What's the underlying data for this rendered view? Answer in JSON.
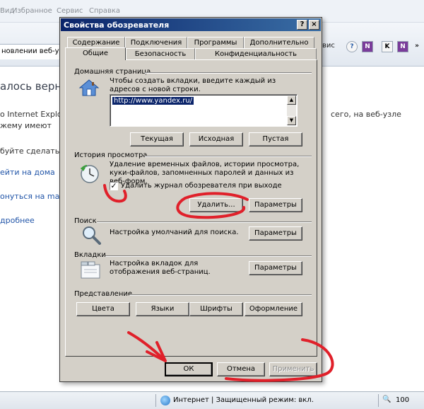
{
  "background_window": {
    "menu": [
      "Вид",
      "Избранное",
      "Сервис",
      "Справка"
    ],
    "tab_label": "новлении веб-узла",
    "toolbar_right_label": "вис",
    "heading": "алось верн",
    "lines": [
      "o Internet Explo",
      "жему имеют",
      "буйте сделать с"
    ],
    "right_lines": [
      "сего, на веб-узле"
    ],
    "links": [
      "ейти на дома",
      "онуться на mai",
      "дробнее"
    ],
    "status": {
      "zone": "Интернет | Защищенный режим: вкл.",
      "zoom": "100"
    }
  },
  "dialog": {
    "title": "Свойства обозревателя",
    "help_button": "?",
    "close_button": "×",
    "tabs_row1": [
      "Содержание",
      "Подключения",
      "Программы",
      "Дополнительно"
    ],
    "tabs_row2": [
      "Общие",
      "Безопасность",
      "Конфиденциальность"
    ],
    "home": {
      "group_label": "Домашняя страница",
      "description": "Чтобы создать вкладки, введите каждый из адресов с новой строки.",
      "url": "http://www.yandex.ru/",
      "buttons": [
        "Текущая",
        "Исходная",
        "Пустая"
      ]
    },
    "history": {
      "group_label": "История просмотра",
      "description": "Удаление временных файлов, истории просмотра, куки-файлов, запомненных паролей и данных из веб-форм.",
      "checkbox_label": "Удалить журнал обозревателя при выходе",
      "checkbox_checked": true,
      "delete_button": "Удалить...",
      "settings_button": "Параметры"
    },
    "search": {
      "group_label": "Поиск",
      "description": "Настройка умолчаний для поиска.",
      "settings_button": "Параметры"
    },
    "tabs_section": {
      "group_label": "Вкладки",
      "description": "Настройка вкладок для отображения веб-страниц.",
      "settings_button": "Параметры"
    },
    "appearance": {
      "group_label": "Представление",
      "buttons": [
        "Цвета",
        "Языки",
        "Шрифты",
        "Оформление"
      ]
    },
    "footer": {
      "ok": "ОК",
      "cancel": "Отмена",
      "apply": "Применить"
    }
  },
  "annotation_color": "#e0202a"
}
